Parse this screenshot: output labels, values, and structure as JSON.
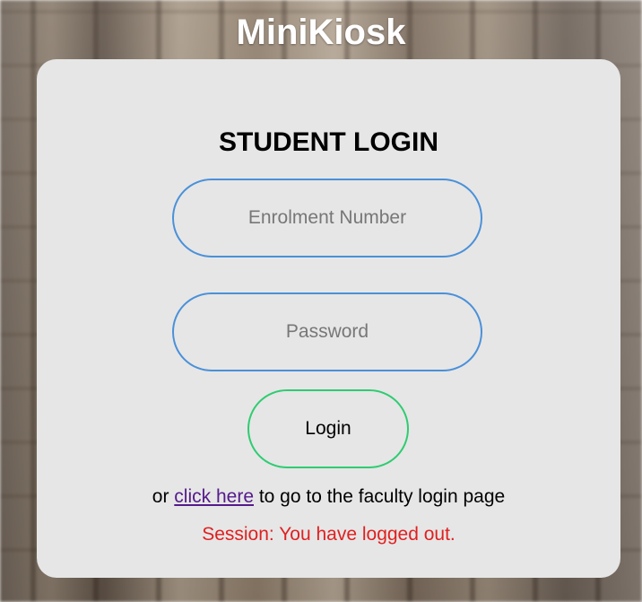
{
  "app": {
    "title": "MiniKiosk"
  },
  "login_form": {
    "heading": "STUDENT LOGIN",
    "enrolment_placeholder": "Enrolment Number",
    "password_placeholder": "Password",
    "login_label": "Login"
  },
  "faculty_link": {
    "prefix": "or ",
    "link_text": "click here",
    "suffix": " to go to the faculty login page"
  },
  "status": {
    "session_message": "Session: You have logged out."
  },
  "colors": {
    "card_background": "#e6e6e6",
    "input_border": "#4a90d9",
    "button_border": "#2ecc71",
    "error_text": "#e02020",
    "link_visited": "#551a8b"
  }
}
